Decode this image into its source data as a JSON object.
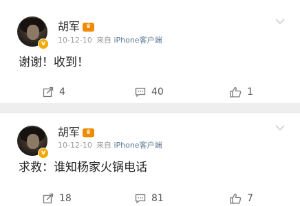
{
  "posts": [
    {
      "author": "胡军",
      "date": "10-12-10",
      "source_prefix": "来自",
      "source_device": "iPhone客户端",
      "text": "谢谢！收到！",
      "reposts": "4",
      "comments": "40",
      "likes": "1",
      "vip_icon": "vip-crown-icon",
      "verified_icon": "verified-badge-icon"
    },
    {
      "author": "胡军",
      "date": "10-12-10",
      "source_prefix": "来自",
      "source_device": "iPhone客户端",
      "text": "求救：谁知杨家火锅电话",
      "reposts": "18",
      "comments": "81",
      "likes": "7",
      "vip_icon": "vip-crown-icon",
      "verified_icon": "verified-badge-icon"
    }
  ],
  "colors": {
    "verified": "#f2a900",
    "vip": "#f08a00",
    "device_link": "#5d7895",
    "separator": "#eeeeee"
  }
}
